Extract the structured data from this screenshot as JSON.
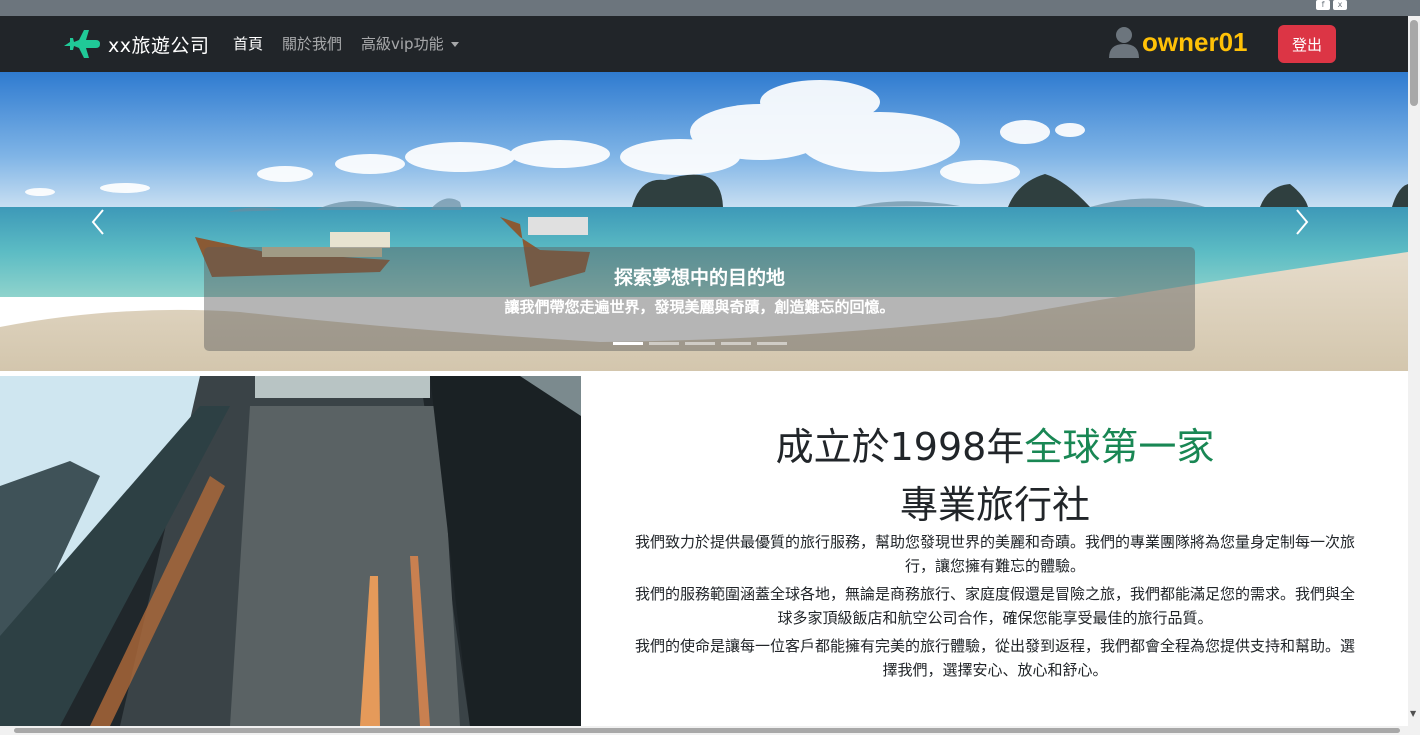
{
  "navbar": {
    "brand": "xx旅遊公司",
    "links": [
      {
        "label": "首頁",
        "active": true
      },
      {
        "label": "關於我們",
        "active": false
      },
      {
        "label": "高級vip功能",
        "active": false,
        "dropdown": true
      }
    ],
    "username": "owner01",
    "logout_label": "登出",
    "brand_icon": "airplane-icon",
    "user_icon": "person-icon"
  },
  "carousel": {
    "title": "探索夢想中的目的地",
    "subtitle": "讓我們帶您走遍世界，發現美麗與奇蹟，創造難忘的回憶。",
    "indicator_count": 5,
    "active_index": 0,
    "prev_icon": "chevron-left-icon",
    "next_icon": "chevron-right-icon"
  },
  "about": {
    "headline_part1": "成立於1998年",
    "headline_highlight": "全球第一家",
    "headline_line2": "專業旅行社",
    "paragraphs": [
      "我們致力於提供最優質的旅行服務，幫助您發現世界的美麗和奇蹟。我們的專業團隊將為您量身定制每一次旅行，讓您擁有難忘的體驗。",
      "我們的服務範圍涵蓋全球各地，無論是商務旅行、家庭度假還是冒險之旅，我們都能滿足您的需求。我們與全球多家頂級飯店和航空公司合作，確保您能享受最佳的旅行品質。",
      "我們的使命是讓每一位客戶都能擁有完美的旅行體驗，從出發到返程，我們都會全程為您提供支持和幫助。選擇我們，選擇安心、放心和舒心。"
    ]
  },
  "colors": {
    "navbar_bg": "#212529",
    "brand_icon": "#20c997",
    "username": "#ffc107",
    "logout": "#dc3545",
    "highlight": "#198754"
  }
}
